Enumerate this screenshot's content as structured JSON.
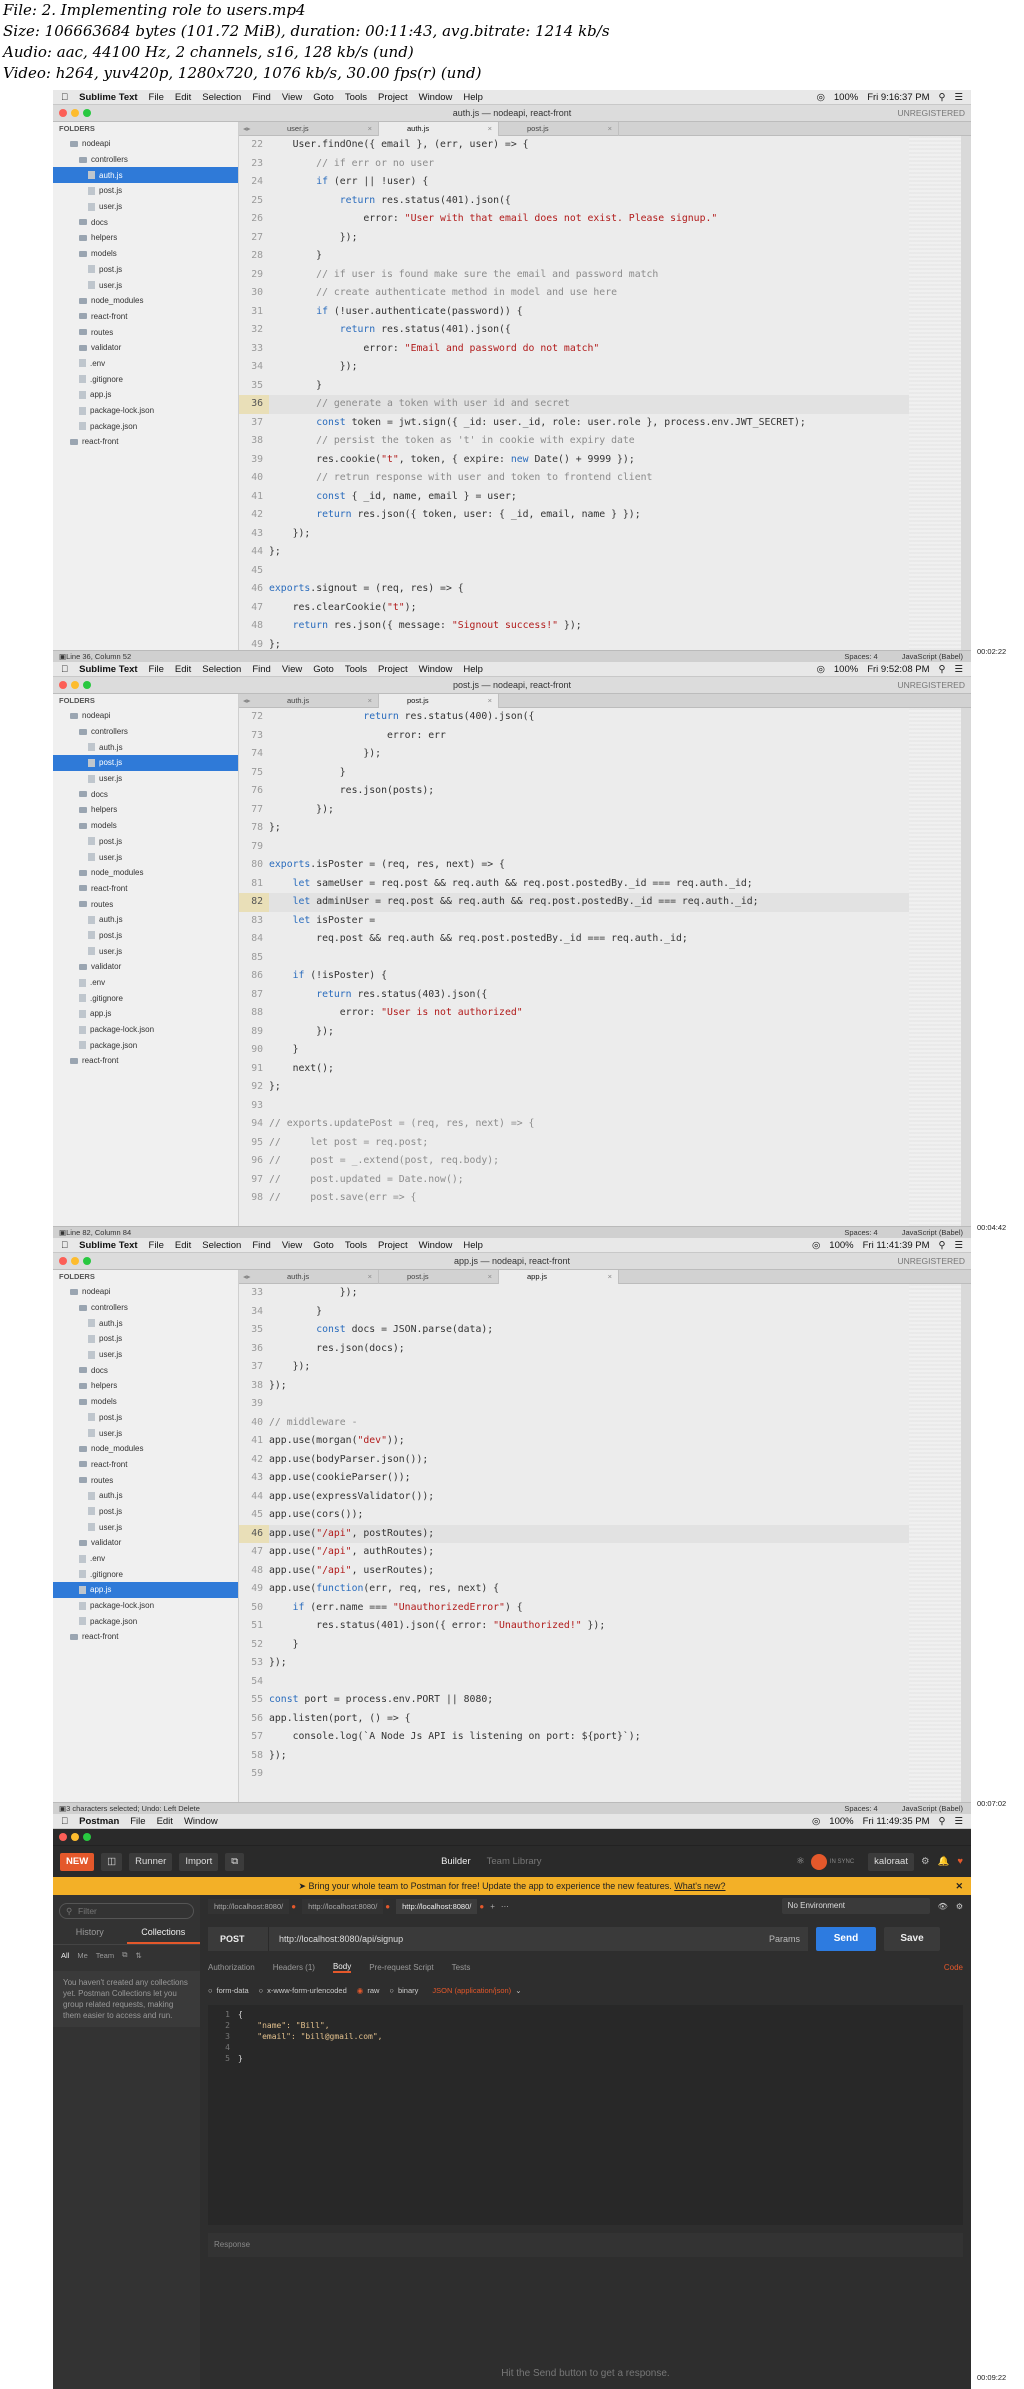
{
  "header": {
    "lines": [
      "File: 2. Implementing role to users.mp4",
      "Size: 106663684 bytes (101.72 MiB), duration: 00:11:43, avg.bitrate: 1214 kb/s",
      "Audio: aac, 44100 Hz, 2 channels, s16, 128 kb/s (und)",
      "Video: h264, yuv420p, 1280x720, 1076 kb/s, 30.00 fps(r) (und)"
    ]
  },
  "menu": {
    "items": [
      "Sublime Text",
      "File",
      "Edit",
      "Selection",
      "Find",
      "View",
      "Goto",
      "Tools",
      "Project",
      "Window",
      "Help"
    ]
  },
  "frames": [
    {
      "menu_clock": "Fri 9:16:37 PM",
      "battery": "100%",
      "title": "auth.js — nodeapi, react-front",
      "unregistered": "UNREGISTERED",
      "folders_label": "FOLDERS",
      "tree": [
        {
          "label": "nodeapi",
          "indent": 1,
          "type": "folder"
        },
        {
          "label": "controllers",
          "indent": 2,
          "type": "folder"
        },
        {
          "label": "auth.js",
          "indent": 3,
          "type": "file",
          "selected": true
        },
        {
          "label": "post.js",
          "indent": 3,
          "type": "file"
        },
        {
          "label": "user.js",
          "indent": 3,
          "type": "file"
        },
        {
          "label": "docs",
          "indent": 2,
          "type": "folder"
        },
        {
          "label": "helpers",
          "indent": 2,
          "type": "folder"
        },
        {
          "label": "models",
          "indent": 2,
          "type": "folder"
        },
        {
          "label": "post.js",
          "indent": 3,
          "type": "file"
        },
        {
          "label": "user.js",
          "indent": 3,
          "type": "file"
        },
        {
          "label": "node_modules",
          "indent": 2,
          "type": "folder"
        },
        {
          "label": "react-front",
          "indent": 2,
          "type": "folder"
        },
        {
          "label": "routes",
          "indent": 2,
          "type": "folder"
        },
        {
          "label": "validator",
          "indent": 2,
          "type": "folder"
        },
        {
          "label": ".env",
          "indent": 2,
          "type": "file"
        },
        {
          "label": ".gitignore",
          "indent": 2,
          "type": "file"
        },
        {
          "label": "app.js",
          "indent": 2,
          "type": "file"
        },
        {
          "label": "package-lock.json",
          "indent": 2,
          "type": "file"
        },
        {
          "label": "package.json",
          "indent": 2,
          "type": "file"
        },
        {
          "label": "react-front",
          "indent": 1,
          "type": "folder"
        }
      ],
      "tabs": [
        {
          "label": "user.js",
          "active": false
        },
        {
          "label": "auth.js",
          "active": true
        },
        {
          "label": "post.js",
          "active": false
        }
      ],
      "code": [
        {
          "n": "22",
          "t": "    User.findOne({ email }, (err, user) => {"
        },
        {
          "n": "23",
          "t": "        // if err or no user"
        },
        {
          "n": "24",
          "t": "        if (err || !user) {"
        },
        {
          "n": "25",
          "t": "            return res.status(401).json({"
        },
        {
          "n": "26",
          "t": "                error: \"User with that email does not exist. Please signup.\""
        },
        {
          "n": "27",
          "t": "            });"
        },
        {
          "n": "28",
          "t": "        }"
        },
        {
          "n": "29",
          "t": "        // if user is found make sure the email and password match"
        },
        {
          "n": "30",
          "t": "        // create authenticate method in model and use here"
        },
        {
          "n": "31",
          "t": "        if (!user.authenticate(password)) {"
        },
        {
          "n": "32",
          "t": "            return res.status(401).json({"
        },
        {
          "n": "33",
          "t": "                error: \"Email and password do not match\""
        },
        {
          "n": "34",
          "t": "            });"
        },
        {
          "n": "35",
          "t": "        }"
        },
        {
          "n": "36",
          "t": "        // generate a token with user id and secret",
          "hl": true
        },
        {
          "n": "37",
          "t": "        const token = jwt.sign({ _id: user._id, role: user.role }, process.env.JWT_SECRET);"
        },
        {
          "n": "38",
          "t": "        // persist the token as 't' in cookie with expiry date"
        },
        {
          "n": "39",
          "t": "        res.cookie(\"t\", token, { expire: new Date() + 9999 });"
        },
        {
          "n": "40",
          "t": "        // retrun response with user and token to frontend client"
        },
        {
          "n": "41",
          "t": "        const { _id, name, email } = user;"
        },
        {
          "n": "42",
          "t": "        return res.json({ token, user: { _id, email, name } });"
        },
        {
          "n": "43",
          "t": "    });"
        },
        {
          "n": "44",
          "t": "};"
        },
        {
          "n": "45",
          "t": ""
        },
        {
          "n": "46",
          "t": "exports.signout = (req, res) => {"
        },
        {
          "n": "47",
          "t": "    res.clearCookie(\"t\");"
        },
        {
          "n": "48",
          "t": "    return res.json({ message: \"Signout success!\" });"
        },
        {
          "n": "49",
          "t": "};"
        }
      ],
      "status_left": "Line 36, Column 52",
      "spaces": "Spaces: 4",
      "syntax": "JavaScript (Babel)",
      "timestamp": "00:02:22"
    },
    {
      "menu_clock": "Fri 9:52:08 PM",
      "battery": "100%",
      "title": "post.js — nodeapi, react-front",
      "unregistered": "UNREGISTERED",
      "folders_label": "FOLDERS",
      "tree": [
        {
          "label": "nodeapi",
          "indent": 1,
          "type": "folder"
        },
        {
          "label": "controllers",
          "indent": 2,
          "type": "folder"
        },
        {
          "label": "auth.js",
          "indent": 3,
          "type": "file"
        },
        {
          "label": "post.js",
          "indent": 3,
          "type": "file",
          "selected": true
        },
        {
          "label": "user.js",
          "indent": 3,
          "type": "file"
        },
        {
          "label": "docs",
          "indent": 2,
          "type": "folder"
        },
        {
          "label": "helpers",
          "indent": 2,
          "type": "folder"
        },
        {
          "label": "models",
          "indent": 2,
          "type": "folder"
        },
        {
          "label": "post.js",
          "indent": 3,
          "type": "file"
        },
        {
          "label": "user.js",
          "indent": 3,
          "type": "file"
        },
        {
          "label": "node_modules",
          "indent": 2,
          "type": "folder"
        },
        {
          "label": "react-front",
          "indent": 2,
          "type": "folder"
        },
        {
          "label": "routes",
          "indent": 2,
          "type": "folder"
        },
        {
          "label": "auth.js",
          "indent": 3,
          "type": "file"
        },
        {
          "label": "post.js",
          "indent": 3,
          "type": "file"
        },
        {
          "label": "user.js",
          "indent": 3,
          "type": "file"
        },
        {
          "label": "validator",
          "indent": 2,
          "type": "folder"
        },
        {
          "label": ".env",
          "indent": 2,
          "type": "file"
        },
        {
          "label": ".gitignore",
          "indent": 2,
          "type": "file"
        },
        {
          "label": "app.js",
          "indent": 2,
          "type": "file"
        },
        {
          "label": "package-lock.json",
          "indent": 2,
          "type": "file"
        },
        {
          "label": "package.json",
          "indent": 2,
          "type": "file"
        },
        {
          "label": "react-front",
          "indent": 1,
          "type": "folder"
        }
      ],
      "tabs": [
        {
          "label": "auth.js",
          "active": false
        },
        {
          "label": "post.js",
          "active": true
        }
      ],
      "code": [
        {
          "n": "72",
          "t": "                return res.status(400).json({"
        },
        {
          "n": "73",
          "t": "                    error: err"
        },
        {
          "n": "74",
          "t": "                });"
        },
        {
          "n": "75",
          "t": "            }"
        },
        {
          "n": "76",
          "t": "            res.json(posts);"
        },
        {
          "n": "77",
          "t": "        });"
        },
        {
          "n": "78",
          "t": "};"
        },
        {
          "n": "79",
          "t": ""
        },
        {
          "n": "80",
          "t": "exports.isPoster = (req, res, next) => {"
        },
        {
          "n": "81",
          "t": "    let sameUser = req.post && req.auth && req.post.postedBy._id === req.auth._id;"
        },
        {
          "n": "82",
          "t": "    let adminUser = req.post && req.auth && req.post.postedBy._id === req.auth._id;",
          "hl": true
        },
        {
          "n": "83",
          "t": "    let isPoster ="
        },
        {
          "n": "84",
          "t": "        req.post && req.auth && req.post.postedBy._id === req.auth._id;"
        },
        {
          "n": "85",
          "t": ""
        },
        {
          "n": "86",
          "t": "    if (!isPoster) {"
        },
        {
          "n": "87",
          "t": "        return res.status(403).json({"
        },
        {
          "n": "88",
          "t": "            error: \"User is not authorized\""
        },
        {
          "n": "89",
          "t": "        });"
        },
        {
          "n": "90",
          "t": "    }"
        },
        {
          "n": "91",
          "t": "    next();"
        },
        {
          "n": "92",
          "t": "};"
        },
        {
          "n": "93",
          "t": ""
        },
        {
          "n": "94",
          "t": "// exports.updatePost = (req, res, next) => {"
        },
        {
          "n": "95",
          "t": "//     let post = req.post;"
        },
        {
          "n": "96",
          "t": "//     post = _.extend(post, req.body);"
        },
        {
          "n": "97",
          "t": "//     post.updated = Date.now();"
        },
        {
          "n": "98",
          "t": "//     post.save(err => {"
        }
      ],
      "status_left": "Line 82, Column 84",
      "spaces": "Spaces: 4",
      "syntax": "JavaScript (Babel)",
      "timestamp": "00:04:42"
    },
    {
      "menu_clock": "Fri 11:41:39 PM",
      "battery": "100%",
      "title": "app.js — nodeapi, react-front",
      "unregistered": "UNREGISTERED",
      "folders_label": "FOLDERS",
      "tree": [
        {
          "label": "nodeapi",
          "indent": 1,
          "type": "folder"
        },
        {
          "label": "controllers",
          "indent": 2,
          "type": "folder"
        },
        {
          "label": "auth.js",
          "indent": 3,
          "type": "file"
        },
        {
          "label": "post.js",
          "indent": 3,
          "type": "file"
        },
        {
          "label": "user.js",
          "indent": 3,
          "type": "file"
        },
        {
          "label": "docs",
          "indent": 2,
          "type": "folder"
        },
        {
          "label": "helpers",
          "indent": 2,
          "type": "folder"
        },
        {
          "label": "models",
          "indent": 2,
          "type": "folder"
        },
        {
          "label": "post.js",
          "indent": 3,
          "type": "file"
        },
        {
          "label": "user.js",
          "indent": 3,
          "type": "file"
        },
        {
          "label": "node_modules",
          "indent": 2,
          "type": "folder"
        },
        {
          "label": "react-front",
          "indent": 2,
          "type": "folder"
        },
        {
          "label": "routes",
          "indent": 2,
          "type": "folder"
        },
        {
          "label": "auth.js",
          "indent": 3,
          "type": "file"
        },
        {
          "label": "post.js",
          "indent": 3,
          "type": "file"
        },
        {
          "label": "user.js",
          "indent": 3,
          "type": "file"
        },
        {
          "label": "validator",
          "indent": 2,
          "type": "folder"
        },
        {
          "label": ".env",
          "indent": 2,
          "type": "file"
        },
        {
          "label": ".gitignore",
          "indent": 2,
          "type": "file"
        },
        {
          "label": "app.js",
          "indent": 2,
          "type": "file",
          "selected": true
        },
        {
          "label": "package-lock.json",
          "indent": 2,
          "type": "file"
        },
        {
          "label": "package.json",
          "indent": 2,
          "type": "file"
        },
        {
          "label": "react-front",
          "indent": 1,
          "type": "folder"
        }
      ],
      "tabs": [
        {
          "label": "auth.js",
          "active": false
        },
        {
          "label": "post.js",
          "active": false
        },
        {
          "label": "app.js",
          "active": true
        }
      ],
      "code": [
        {
          "n": "33",
          "t": "            });"
        },
        {
          "n": "34",
          "t": "        }"
        },
        {
          "n": "35",
          "t": "        const docs = JSON.parse(data);"
        },
        {
          "n": "36",
          "t": "        res.json(docs);"
        },
        {
          "n": "37",
          "t": "    });"
        },
        {
          "n": "38",
          "t": "});"
        },
        {
          "n": "39",
          "t": ""
        },
        {
          "n": "40",
          "t": "// middleware -"
        },
        {
          "n": "41",
          "t": "app.use(morgan(\"dev\"));"
        },
        {
          "n": "42",
          "t": "app.use(bodyParser.json());"
        },
        {
          "n": "43",
          "t": "app.use(cookieParser());"
        },
        {
          "n": "44",
          "t": "app.use(expressValidator());"
        },
        {
          "n": "45",
          "t": "app.use(cors());"
        },
        {
          "n": "46",
          "t": "app.use(\"/api\", postRoutes);",
          "hl": true
        },
        {
          "n": "47",
          "t": "app.use(\"/api\", authRoutes);"
        },
        {
          "n": "48",
          "t": "app.use(\"/api\", userRoutes);"
        },
        {
          "n": "49",
          "t": "app.use(function(err, req, res, next) {"
        },
        {
          "n": "50",
          "t": "    if (err.name === \"UnauthorizedError\") {"
        },
        {
          "n": "51",
          "t": "        res.status(401).json({ error: \"Unauthorized!\" });"
        },
        {
          "n": "52",
          "t": "    }"
        },
        {
          "n": "53",
          "t": "});"
        },
        {
          "n": "54",
          "t": ""
        },
        {
          "n": "55",
          "t": "const port = process.env.PORT || 8080;"
        },
        {
          "n": "56",
          "t": "app.listen(port, () => {"
        },
        {
          "n": "57",
          "t": "    console.log(`A Node Js API is listening on port: ${port}`);"
        },
        {
          "n": "58",
          "t": "});"
        },
        {
          "n": "59",
          "t": ""
        }
      ],
      "status_left": "3 characters selected; Undo: Left Delete",
      "spaces": "Spaces: 4",
      "syntax": "JavaScript (Babel)",
      "timestamp": "00:07:02"
    }
  ],
  "postman": {
    "menu": [
      "Postman",
      "File",
      "Edit",
      "Window"
    ],
    "menu_clock": "Fri 11:49:35 PM",
    "battery": "100%",
    "new_label": "NEW",
    "runner_label": "Runner",
    "import_label": "Import",
    "builder_label": "Builder",
    "team_label": "Team Library",
    "sync_label": "IN SYNC",
    "user_label": "kaloraat",
    "banner_text": "Bring your whole team to Postman for free! Update the app to experience the new features.",
    "banner_link": "What's new?",
    "filter_placeholder": "Filter",
    "history_tab": "History",
    "collections_tab": "Collections",
    "side_filters": [
      "All",
      "Me",
      "Team"
    ],
    "empty_text": "You haven't created any collections yet. Postman Collections let you group related requests, making them easier to access and run.",
    "req_tabs": [
      "http://localhost:8080/",
      "http://localhost:8080/",
      "http://localhost:8080/"
    ],
    "environment": "No Environment",
    "method": "POST",
    "url": "http://localhost:8080/api/signup",
    "params_label": "Params",
    "send_label": "Send",
    "save_label": "Save",
    "sub_tabs": [
      "Authorization",
      "Headers (1)",
      "Body",
      "Pre-request Script",
      "Tests"
    ],
    "code_label": "Code",
    "body_types": [
      "form-data",
      "x-www-form-urlencoded",
      "raw",
      "binary"
    ],
    "json_label": "JSON (application/json)",
    "body": [
      {
        "n": "1",
        "t": "{"
      },
      {
        "n": "2",
        "t": "    \"name\": \"Bill\","
      },
      {
        "n": "3",
        "t": "    \"email\": \"bill@gmail.com\","
      },
      {
        "n": "4",
        "t": "    "
      },
      {
        "n": "5",
        "t": "}"
      }
    ],
    "response_label": "Response",
    "response_hint": "Hit the Send button to get a response.",
    "timestamp": "00:09:22"
  }
}
